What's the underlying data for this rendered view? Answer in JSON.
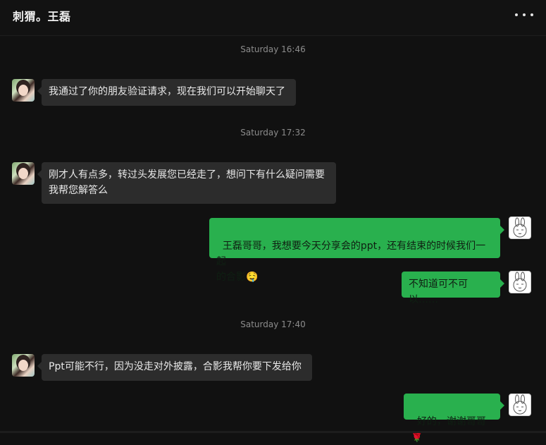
{
  "header": {
    "title": "刺猬。王磊",
    "more_icon": "more-dots-icon"
  },
  "messages": [
    {
      "type": "timestamp",
      "text": "Saturday 16:46"
    },
    {
      "type": "in",
      "text": "我通过了你的朋友验证请求，现在我们可以开始聊天了"
    },
    {
      "type": "timestamp",
      "text": "Saturday 17:32"
    },
    {
      "type": "in",
      "text": "刚才人有点多，转过头发展您已经走了，想问下有什么疑问需要\n我帮您解答么"
    },
    {
      "type": "out",
      "text": "王磊哥哥，我想要今天分享会的ppt，还有结束的时候我们一起\n的合影",
      "emoji": "🤤"
    },
    {
      "type": "out",
      "text": "不知道可不可以……"
    },
    {
      "type": "timestamp",
      "text": "Saturday 17:40"
    },
    {
      "type": "in",
      "text": "Ppt可能不行，因为没走对外披露，合影我帮你要下发给你"
    },
    {
      "type": "out",
      "text": "好的，谢谢哥哥",
      "emoji": "🌹"
    }
  ],
  "colors": {
    "background": "#111111",
    "incoming_bubble": "#2c2c2c",
    "outgoing_bubble": "#29b04e",
    "timestamp_text": "#8c8c8c"
  }
}
